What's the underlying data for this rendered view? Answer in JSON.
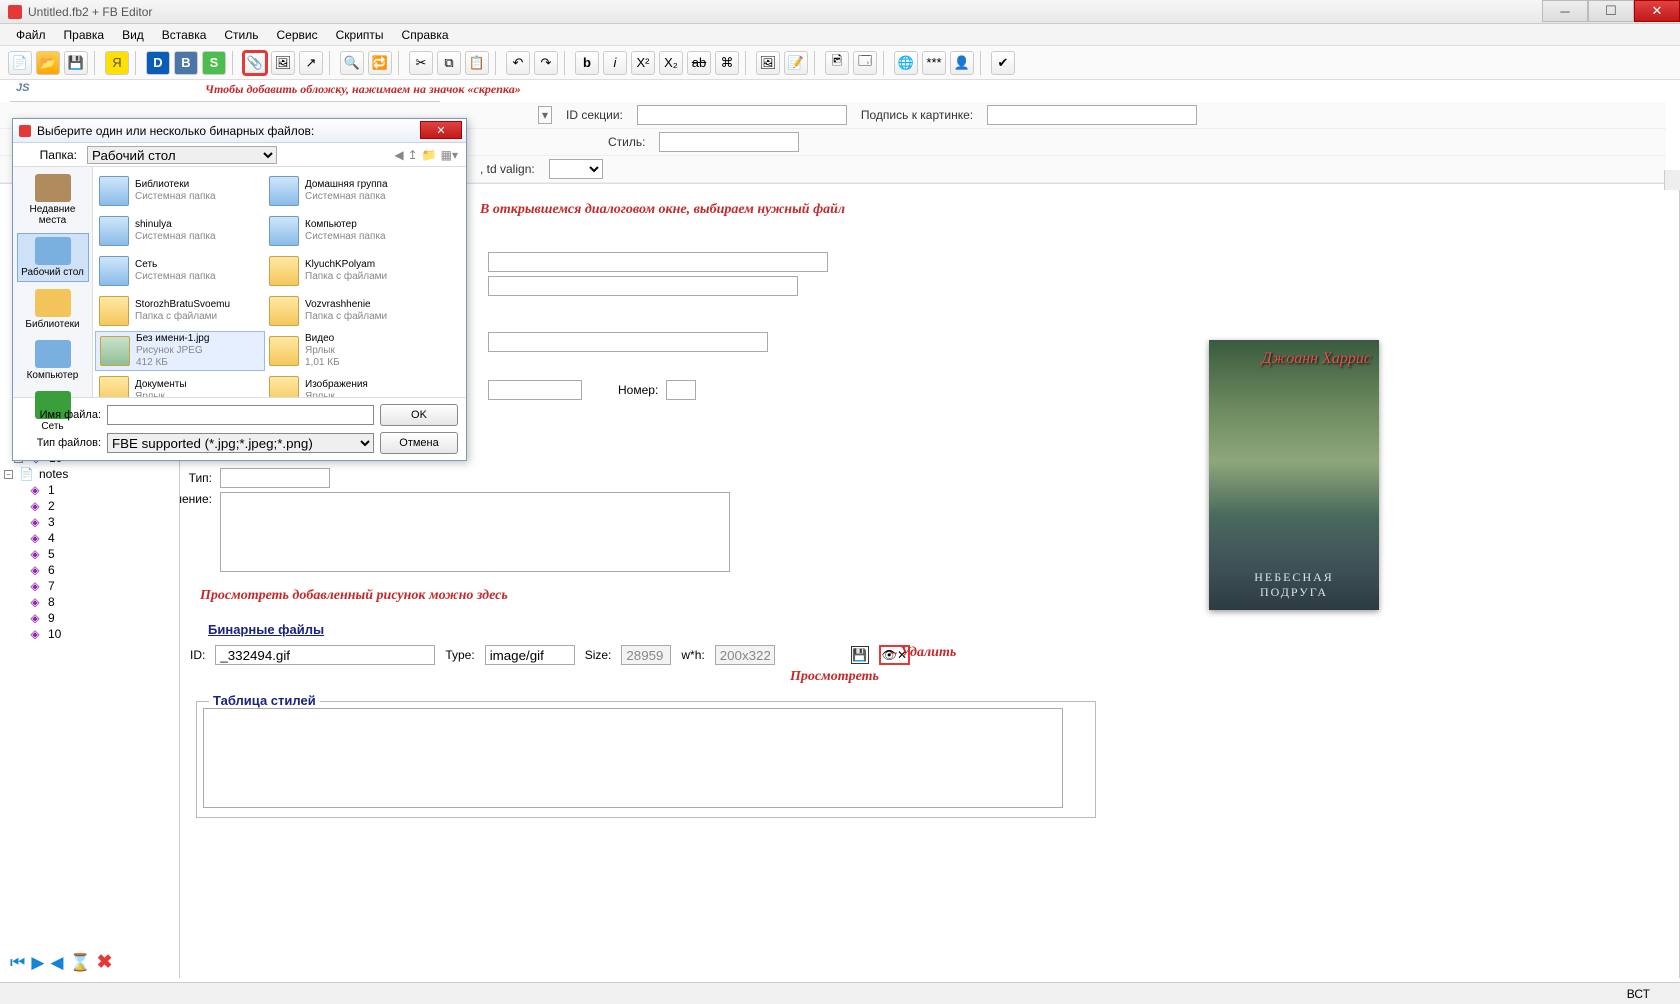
{
  "window": {
    "title": "Untitled.fb2 + FB Editor",
    "child_title": "Untitled.fb2 + FB Editor"
  },
  "menu": [
    "Файл",
    "Правка",
    "Вид",
    "Вставка",
    "Стиль",
    "Сервис",
    "Скрипты",
    "Справка"
  ],
  "hints": {
    "toolbar": "Чтобы добавить обложку, нажимаем на значок «скрепка»",
    "dialog": "В открывшемся диалоговом окне, выбираем нужный файл",
    "preview": "Просмотреть добавленный рисунок можно здесь",
    "delete": "– Удалить",
    "viewhere": "Просмотреть"
  },
  "propbar": {
    "row1": {
      "idsec_label": "ID секции:",
      "caption_label": "Подпись к картинке:",
      "idsec_val": "",
      "caption_val": ""
    },
    "row2": {
      "style_label": "Стиль:",
      "style_val": ""
    },
    "row3": {
      "tdvalign_label": ", td valign:",
      "tdvalign_val": ""
    }
  },
  "tree": {
    "nodes": [
      {
        "icon": "◈",
        "label": "10"
      },
      {
        "type": "group",
        "expand": "−",
        "icon": "",
        "label": "notes"
      },
      {
        "icon": "◈",
        "label": "1"
      },
      {
        "icon": "◈",
        "label": "2"
      },
      {
        "icon": "◈",
        "label": "3"
      },
      {
        "icon": "◈",
        "label": "4"
      },
      {
        "icon": "◈",
        "label": "5"
      },
      {
        "icon": "◈",
        "label": "6"
      },
      {
        "icon": "◈",
        "label": "7"
      },
      {
        "icon": "◈",
        "label": "8"
      },
      {
        "icon": "◈",
        "label": "9"
      },
      {
        "icon": "◈",
        "label": "10"
      }
    ]
  },
  "form": {
    "number_label": "Номер:",
    "type_label": "Тип:",
    "value_label": "Значение:",
    "number_val": "",
    "type_val": "",
    "value_val": ""
  },
  "binary": {
    "section_title": "Бинарные файлы",
    "id_label": "ID:",
    "id_val": "_332494.gif",
    "type_label": "Type:",
    "type_val": "image/gif",
    "size_label": "Size:",
    "size_val": "28959",
    "wh_label": "w*h:",
    "wh_val": "200x322"
  },
  "cover": {
    "author": "Джоанн Харрис",
    "title_line1": "НЕБЕСНАЯ",
    "title_line2": "ПОДРУГА"
  },
  "styletable": {
    "title": "Таблица стилей",
    "value": ""
  },
  "filedlg": {
    "title": "Выберите один или несколько бинарных файлов:",
    "folder_label": "Папка:",
    "folder_val": "Рабочий стол",
    "places": [
      "Недавние места",
      "Рабочий стол",
      "Библиотеки",
      "Компьютер",
      "Сеть"
    ],
    "files": [
      {
        "name": "Библиотеки",
        "desc": "Системная папка",
        "kind": "sys"
      },
      {
        "name": "Домашняя группа",
        "desc": "Системная папка",
        "kind": "sys"
      },
      {
        "name": "shinulya",
        "desc": "Системная папка",
        "kind": "sys"
      },
      {
        "name": "Компьютер",
        "desc": "Системная папка",
        "kind": "sys"
      },
      {
        "name": "Сеть",
        "desc": "Системная папка",
        "kind": "sys"
      },
      {
        "name": "KlyuchKPolyam",
        "desc": "Папка с файлами",
        "kind": "folder"
      },
      {
        "name": "StorozhBratuSvoemu",
        "desc": "Папка с файлами",
        "kind": "folder"
      },
      {
        "name": "Vozvrashhenie",
        "desc": "Папка с файлами",
        "kind": "folder"
      },
      {
        "name": "Без имени-1.jpg",
        "desc": "Рисунок JPEG",
        "desc2": "412 КБ",
        "kind": "img",
        "sel": true
      },
      {
        "name": "Видео",
        "desc": "Ярлык",
        "desc2": "1,01 КБ",
        "kind": "folder"
      },
      {
        "name": "Документы",
        "desc": "Ярлык",
        "kind": "folder"
      },
      {
        "name": "Изображения",
        "desc": "Ярлык",
        "kind": "folder"
      }
    ],
    "filename_label": "Имя файла:",
    "filename_val": "",
    "filetype_label": "Тип файлов:",
    "filetype_val": "FBE supported (*.jpg;*.jpeg;*.png)",
    "ok": "OK",
    "cancel": "Отмена"
  },
  "status": {
    "mode": "ВСТ"
  }
}
